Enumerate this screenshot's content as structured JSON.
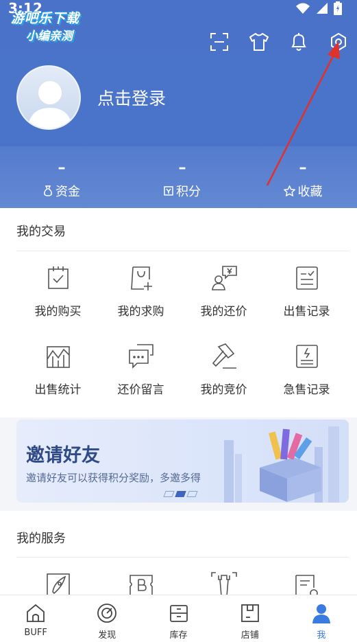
{
  "status": {
    "time": "3:12"
  },
  "watermark": {
    "line1": "游吧乐下载",
    "line2": "小编亲测"
  },
  "header": {
    "actions": [
      {
        "icon": "scan-icon"
      },
      {
        "icon": "tshirt-icon"
      },
      {
        "icon": "bell-icon"
      },
      {
        "icon": "settings-gear-icon"
      }
    ],
    "login_text": "点击登录",
    "stats": [
      {
        "value": "–",
        "label": "资金",
        "icon": "money-bag-icon"
      },
      {
        "value": "–",
        "label": "积分",
        "icon": "points-icon"
      },
      {
        "value": "–",
        "label": "收藏",
        "icon": "star-icon"
      }
    ]
  },
  "trade": {
    "title": "我的交易",
    "items": [
      {
        "label": "我的购买",
        "icon": "calendar-check-icon"
      },
      {
        "label": "我的求购",
        "icon": "bag-plus-icon"
      },
      {
        "label": "我的还价",
        "icon": "bargain-person-icon"
      },
      {
        "label": "出售记录",
        "icon": "sale-record-icon"
      },
      {
        "label": "出售统计",
        "icon": "sale-stats-icon"
      },
      {
        "label": "还价留言",
        "icon": "message-icon"
      },
      {
        "label": "我的竞价",
        "icon": "auction-hammer-icon"
      },
      {
        "label": "急售记录",
        "icon": "urgent-record-icon"
      }
    ]
  },
  "banner": {
    "title": "邀请好友",
    "subtitle": "邀请好友可以获得积分奖励，多邀多得",
    "page_index": 2,
    "page_count": 3
  },
  "services": {
    "title": "我的服务",
    "items": [
      {
        "icon": "rocket-icon"
      },
      {
        "icon": "b-ticket-icon"
      },
      {
        "icon": "tower-icon"
      },
      {
        "icon": "guide-book-icon"
      }
    ]
  },
  "bottom_nav": [
    {
      "label": "BUFF",
      "icon": "home-icon",
      "active": false
    },
    {
      "label": "发现",
      "icon": "discover-icon",
      "active": false
    },
    {
      "label": "库存",
      "icon": "inventory-icon",
      "active": false
    },
    {
      "label": "店铺",
      "icon": "store-icon",
      "active": false
    },
    {
      "label": "我",
      "icon": "me-icon",
      "active": true
    }
  ],
  "colors": {
    "header_blue": "#4a72c9",
    "accent": "#3a7be0",
    "annotation_red": "#e0312b"
  }
}
